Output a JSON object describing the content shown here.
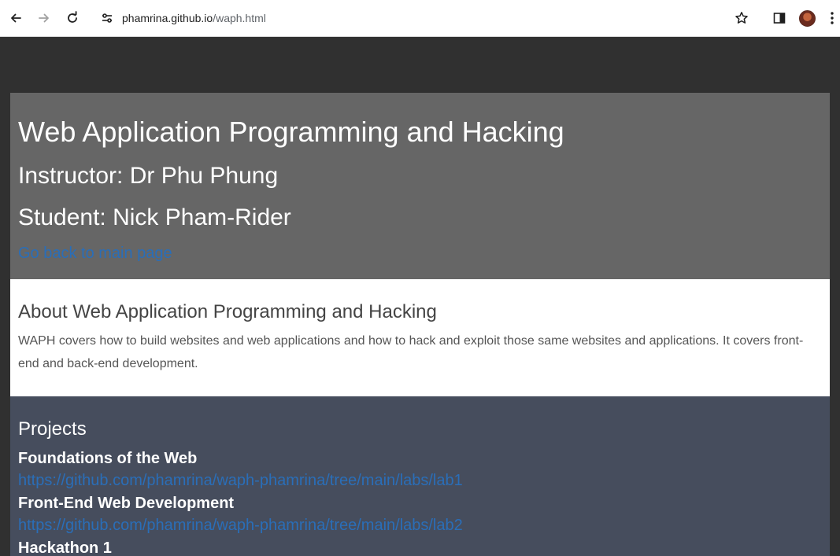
{
  "browser": {
    "url_host": "phamrina.github.io",
    "url_path": "/waph.html"
  },
  "header": {
    "title": "Web Application Programming and Hacking",
    "instructor": "Instructor: Dr Phu Phung",
    "student": "Student: Nick Pham-Rider",
    "back_link": "Go back to main page"
  },
  "about": {
    "heading": "About Web Application Programming and Hacking",
    "text": "WAPH covers how to build websites and web applications and how to hack and exploit those same websites and applications. It covers front-end and back-end development."
  },
  "projects": {
    "heading": "Projects",
    "items": [
      {
        "name": "Foundations of the Web",
        "link": "https://github.com/phamrina/waph-phamrina/tree/main/labs/lab1"
      },
      {
        "name": "Front-End Web Development",
        "link": "https://github.com/phamrina/waph-phamrina/tree/main/labs/lab2"
      },
      {
        "name": "Hackathon 1"
      }
    ]
  },
  "colors": {
    "page_bg": "#303030",
    "header_bg": "#666666",
    "about_bg": "#ffffff",
    "projects_bg": "#464d5d",
    "link": "#2a6eb8"
  },
  "icons": [
    "back-arrow-icon",
    "forward-arrow-icon",
    "reload-icon",
    "site-info-icon",
    "star-icon",
    "side-panel-icon",
    "profile-avatar",
    "kebab-menu-icon"
  ]
}
